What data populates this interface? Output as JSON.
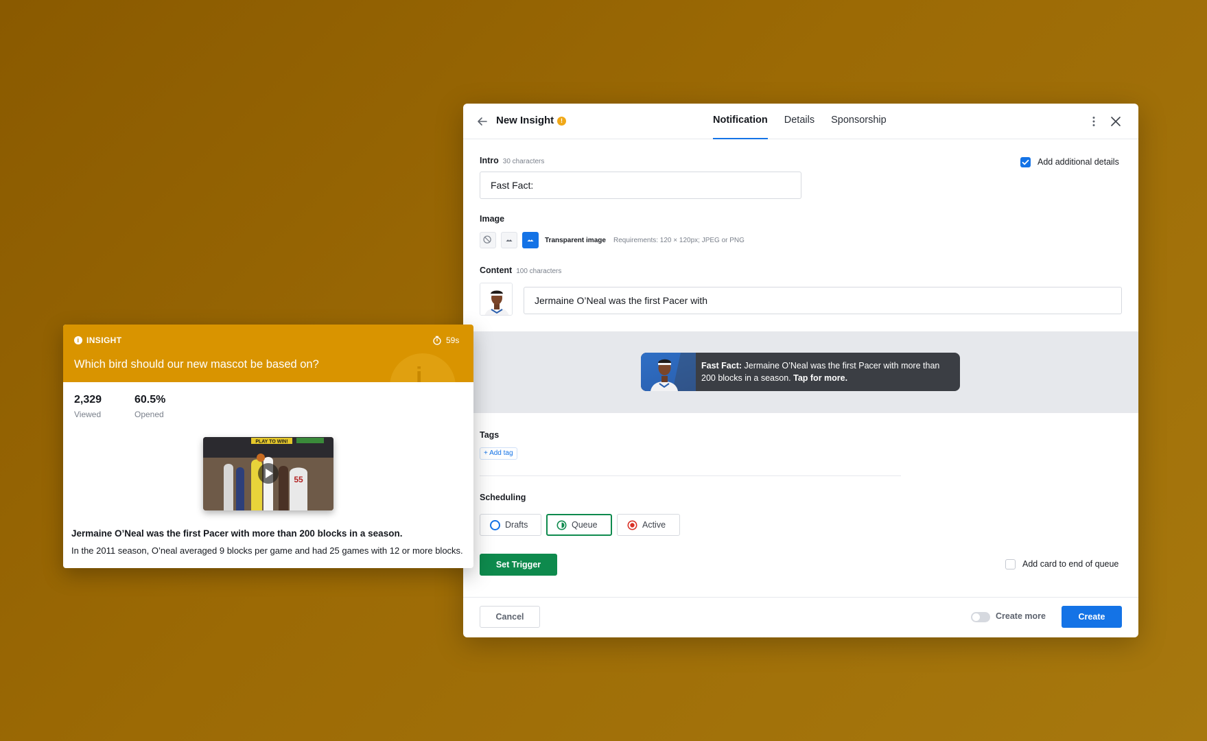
{
  "modal": {
    "title": "New Insight",
    "warning_glyph": "!",
    "tabs": [
      "Notification",
      "Details",
      "Sponsorship"
    ],
    "active_tab": "Notification",
    "intro": {
      "label": "Intro",
      "hint": "30 characters",
      "value": "Fast Fact:"
    },
    "add_details": {
      "label": "Add additional details",
      "checked": true
    },
    "image": {
      "label": "Image",
      "selected_label": "Transparent image",
      "requirements": "Requirements: 120 × 120px; JPEG or PNG",
      "options": [
        "none-icon",
        "image-icon",
        "transparent-image-icon"
      ]
    },
    "content": {
      "label": "Content",
      "hint": "100 characters",
      "value": "Jermaine O’Neal was the first Pacer with"
    },
    "preview": {
      "bold_prefix": "Fast Fact:",
      "text": " Jermaine O’Neal was the first Pacer with more than 200 blocks in a season. ",
      "cta": "Tap for more."
    },
    "tags": {
      "label": "Tags",
      "add_label": "+ Add tag"
    },
    "scheduling": {
      "label": "Scheduling",
      "options": [
        {
          "label": "Drafts",
          "color": "#1473e6",
          "selected": false
        },
        {
          "label": "Queue",
          "color": "#0e8a4d",
          "selected": true
        },
        {
          "label": "Active",
          "color": "#d93025",
          "selected": false
        }
      ]
    },
    "set_trigger_label": "Set Trigger",
    "end_of_queue": {
      "label": "Add card to end of queue",
      "checked": false
    },
    "footer": {
      "cancel_label": "Cancel",
      "create_more_label": "Create more",
      "create_label": "Create"
    }
  },
  "card": {
    "kicker": "INSIGHT",
    "info_glyph": "i",
    "timer": "59s",
    "question": "Which bird should our new mascot be based on?",
    "stats": [
      {
        "value": "2,329",
        "label": "Viewed"
      },
      {
        "value": "60.5%",
        "label": "Opened"
      }
    ],
    "video_banner": "PLAY TO WIN!",
    "headline": "Jermaine O’Neal was the first Pacer with more than 200 blocks in a season.",
    "body": "In the 2011 season, O’neal averaged 9 blocks per game and had 25 games with 12 or more blocks."
  },
  "colors": {
    "background": "#9c6a05",
    "accent_blue": "#1473e6",
    "insight_orange": "#d99400",
    "queue_green": "#0e8a4d"
  }
}
